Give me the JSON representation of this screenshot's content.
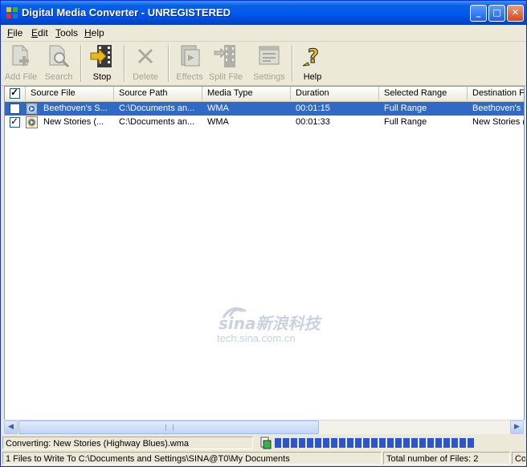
{
  "window": {
    "title": "Digital Media Converter - UNREGISTERED",
    "controls": {
      "minimize": "_",
      "maximize": "□",
      "close": "✕"
    }
  },
  "menu": [
    {
      "first": "F",
      "rest": "ile"
    },
    {
      "first": "E",
      "rest": "dit"
    },
    {
      "first": "T",
      "rest": "ools"
    },
    {
      "first": "H",
      "rest": "elp"
    }
  ],
  "toolbar": {
    "add_file": "Add File",
    "search": "Search",
    "stop": "Stop",
    "delete": "Delete",
    "effects": "Effects",
    "split_file": "Split File",
    "settings": "Settings",
    "help": "Help"
  },
  "columns": [
    "Source File",
    "Source Path",
    "Media Type",
    "Duration",
    "Selected Range",
    "Destination F"
  ],
  "rows": [
    {
      "checked": false,
      "selected": true,
      "source_file": "Beethoven's S...",
      "source_path": "C:\\Documents an...",
      "media_type": "WMA",
      "duration": "00:01:15",
      "selected_range": "Full Range",
      "destination": "Beethoven's S"
    },
    {
      "checked": true,
      "selected": false,
      "source_file": "New Stories (...",
      "source_path": "C:\\Documents an...",
      "media_type": "WMA",
      "duration": "00:01:33",
      "selected_range": "Full Range",
      "destination": "New Stories ("
    }
  ],
  "watermark": {
    "brand": "sina新浪科技",
    "url": "tech.sina.com.cn"
  },
  "status": {
    "converting": "Converting: New Stories (Highway Blues).wma",
    "progress_blocks": 25,
    "files_to_write": "1 Files to Write To C:\\Documents and Settings\\SINA@T0\\My Documents",
    "total_files": "Total number of Files: 2",
    "extra": "Co"
  },
  "colors": {
    "selection": "#316ac5",
    "titlebar": "#0058ee",
    "progress": "#2b55c8"
  }
}
